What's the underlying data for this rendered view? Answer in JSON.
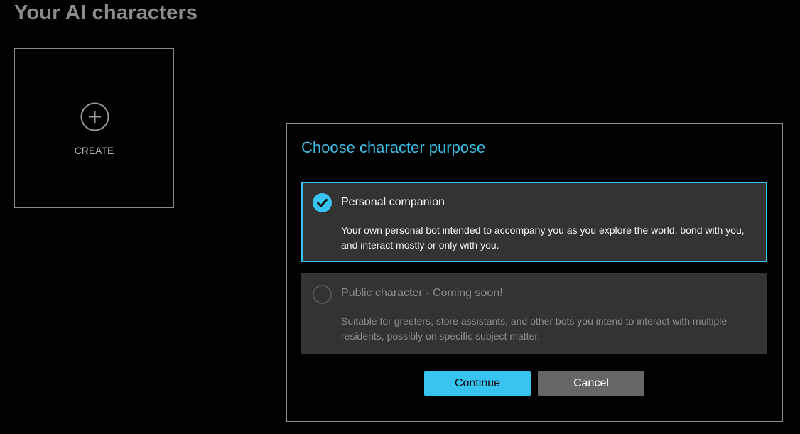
{
  "page": {
    "title": "Your AI characters"
  },
  "create_card": {
    "icon": "plus-circle-icon",
    "label": "CREATE"
  },
  "dialog": {
    "title": "Choose character purpose",
    "options": [
      {
        "title": "Personal companion",
        "description": "Your own personal bot intended to accompany you as you explore the world, bond with you, and interact mostly or only with you.",
        "selected": true,
        "enabled": true,
        "icon": "check-circle-icon"
      },
      {
        "title": "Public character - Coming soon!",
        "description": "Suitable for greeters, store assistants, and other bots you intend to interact with multiple residents, possibly on specific subject matter.",
        "selected": false,
        "enabled": false,
        "icon": "radio-empty-icon"
      }
    ],
    "continue_label": "Continue",
    "cancel_label": "Cancel"
  },
  "colors": {
    "background": "#000000",
    "accent": "#38c4f0",
    "title_accent": "#3dbfe8",
    "panel": "#333333",
    "muted_text": "#8c8c8c",
    "cancel_button": "#666666"
  }
}
